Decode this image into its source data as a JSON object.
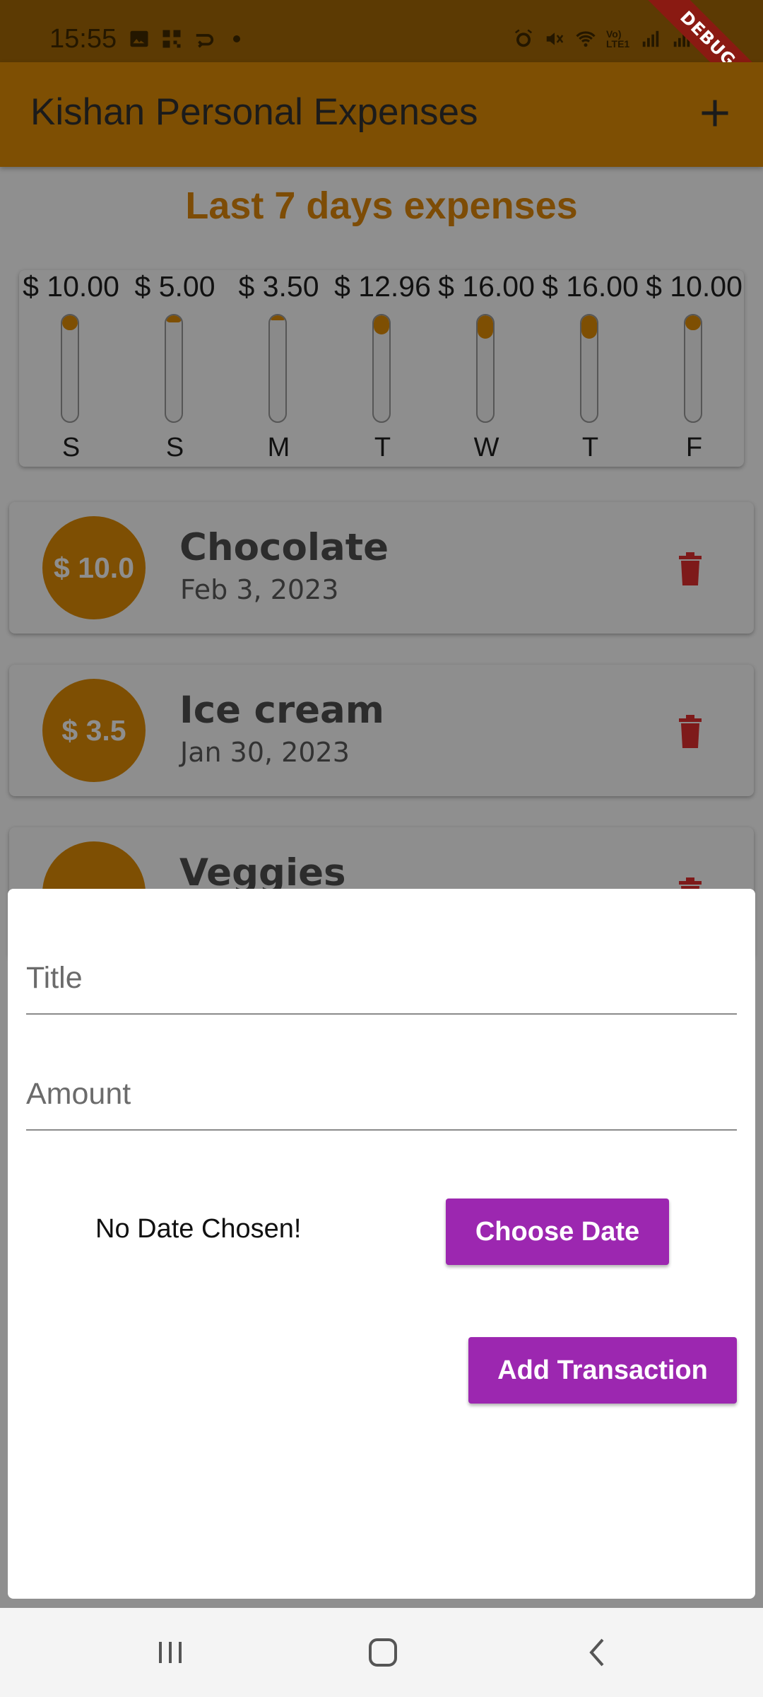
{
  "status_bar": {
    "time": "15:55",
    "left_icons": [
      "image-icon",
      "qr-icon",
      "forward-icon",
      "dot-icon"
    ],
    "right_icons": [
      "alarm-icon",
      "mute-icon",
      "wifi-icon",
      "volte-lte-icon",
      "signal-icon",
      "signal-icon",
      "battery-icon"
    ],
    "network_label": "Vo) LTE1",
    "debug_label": "DEBUG"
  },
  "app_bar": {
    "title": "Kishan Personal Expenses",
    "add_icon": "plus-icon"
  },
  "heading": "Last 7 days expenses",
  "chart_data": {
    "type": "bar",
    "categories": [
      "S",
      "S",
      "M",
      "T",
      "W",
      "T",
      "F"
    ],
    "values": [
      10.0,
      5.0,
      3.5,
      12.96,
      16.0,
      16.0,
      10.0
    ],
    "value_labels": [
      "$ 10.00",
      "$ 5.00",
      "$ 3.50",
      "$ 12.96",
      "$ 16.00",
      "$ 16.00",
      "$ 10.00"
    ],
    "fill_fraction": [
      0.137,
      0.068,
      0.048,
      0.178,
      0.219,
      0.219,
      0.137
    ],
    "title": "Last 7 days expenses",
    "accent": "#e69a0c"
  },
  "transactions": [
    {
      "amount": "$ 10.0",
      "title": "Chocolate",
      "date": "Feb 3, 2023"
    },
    {
      "amount": "$ 3.5",
      "title": "Ice cream",
      "date": "Jan 30, 2023"
    },
    {
      "amount": "",
      "title": "Veggies",
      "date": ""
    }
  ],
  "form": {
    "title_placeholder": "Title",
    "amount_placeholder": "Amount",
    "date_label": "No Date Chosen!",
    "choose_date_label": "Choose Date",
    "add_button_label": "Add Transaction"
  },
  "nav_bar": {
    "icons": [
      "recent-apps-icon",
      "home-icon",
      "back-icon"
    ]
  },
  "colors": {
    "primary": "#e69a0c",
    "button": "#9c27b0",
    "delete": "#c62828"
  }
}
